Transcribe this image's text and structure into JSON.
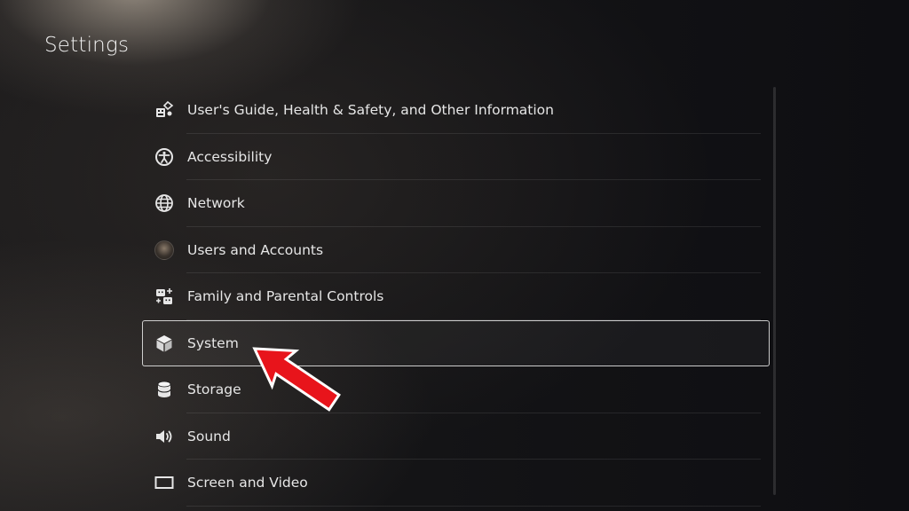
{
  "page": {
    "title": "Settings"
  },
  "menu": {
    "items": [
      {
        "label": "User's Guide, Health & Safety, and Other Information",
        "icon": "info-cube-icon"
      },
      {
        "label": "Accessibility",
        "icon": "accessibility-icon"
      },
      {
        "label": "Network",
        "icon": "globe-icon"
      },
      {
        "label": "Users and Accounts",
        "icon": "user-avatar-icon"
      },
      {
        "label": "Family and Parental Controls",
        "icon": "family-icon"
      },
      {
        "label": "System",
        "icon": "cube-icon"
      },
      {
        "label": "Storage",
        "icon": "storage-cylinder-icon"
      },
      {
        "label": "Sound",
        "icon": "speaker-icon"
      },
      {
        "label": "Screen and Video",
        "icon": "screen-icon"
      }
    ],
    "selected_index": 5
  },
  "colors": {
    "annotation_arrow": "#e8141b",
    "text": "#e6e6e6"
  }
}
